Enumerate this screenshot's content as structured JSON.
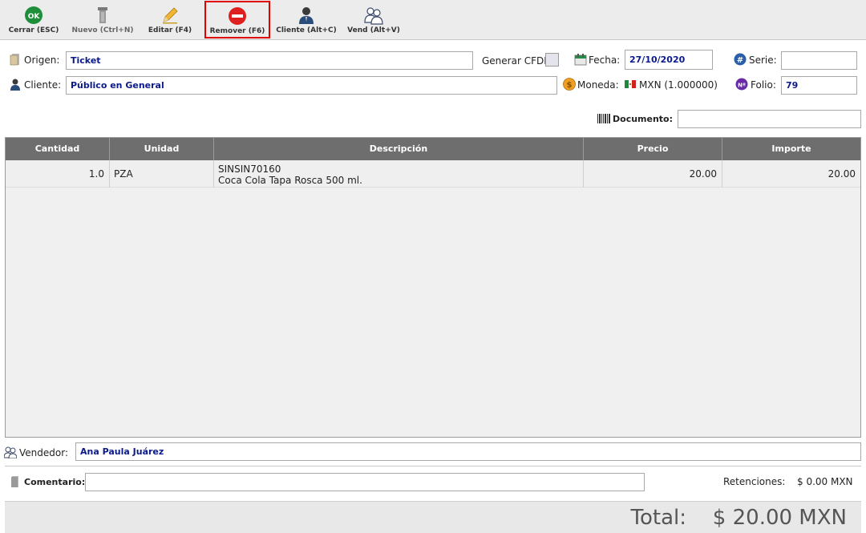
{
  "toolbar": {
    "buttons": [
      {
        "label": "Cerrar (ESC)",
        "icon": "ok-icon"
      },
      {
        "label": "Nuevo (Ctrl+N)",
        "icon": "new-document-icon"
      },
      {
        "label": "Editar (F4)",
        "icon": "pencil-icon"
      },
      {
        "label": "Remover (F6)",
        "icon": "remove-icon"
      },
      {
        "label": "Cliente (Alt+C)",
        "icon": "client-icon"
      },
      {
        "label": "Vend (Alt+V)",
        "icon": "sellers-icon"
      }
    ],
    "ok_glyph": "OK"
  },
  "form": {
    "origen_label": "Origen:",
    "origen_value": "Ticket",
    "generar_cfdi_label": "Generar CFDI",
    "fecha_label": "Fecha:",
    "fecha_value": "27/10/2020",
    "serie_label": "Serie:",
    "serie_value": "",
    "cliente_label": "Cliente:",
    "cliente_value": "Público en General",
    "moneda_label": "Moneda:",
    "moneda_value": "MXN (1.000000)",
    "folio_label": "Folio:",
    "folio_value": "79",
    "documento_label": "Documento:",
    "documento_value": ""
  },
  "grid": {
    "columns": [
      "Cantidad",
      "Unidad",
      "Descripción",
      "Precio",
      "Importe"
    ],
    "rows": [
      {
        "cantidad": "1.0",
        "unidad": "PZA",
        "codigo": "SINSIN70160",
        "descripcion": "Coca Cola Tapa Rosca 500 ml.",
        "precio": "20.00",
        "importe": "20.00"
      }
    ]
  },
  "footer": {
    "vendedor_label": "Vendedor:",
    "vendedor_value": "Ana Paula Juárez",
    "comentario_label": "Comentario:",
    "comentario_value": "",
    "retenciones_label": "Retenciones:",
    "retenciones_value": "$ 0.00 MXN",
    "total_label": "Total:",
    "total_value": "$ 20.00 MXN"
  },
  "colors": {
    "accent_green": "#1d8f3a",
    "remove_red": "#e02020",
    "highlight_border": "#e00000",
    "field_text": "#0a1a8a",
    "grid_header": "#6e6e6e"
  }
}
